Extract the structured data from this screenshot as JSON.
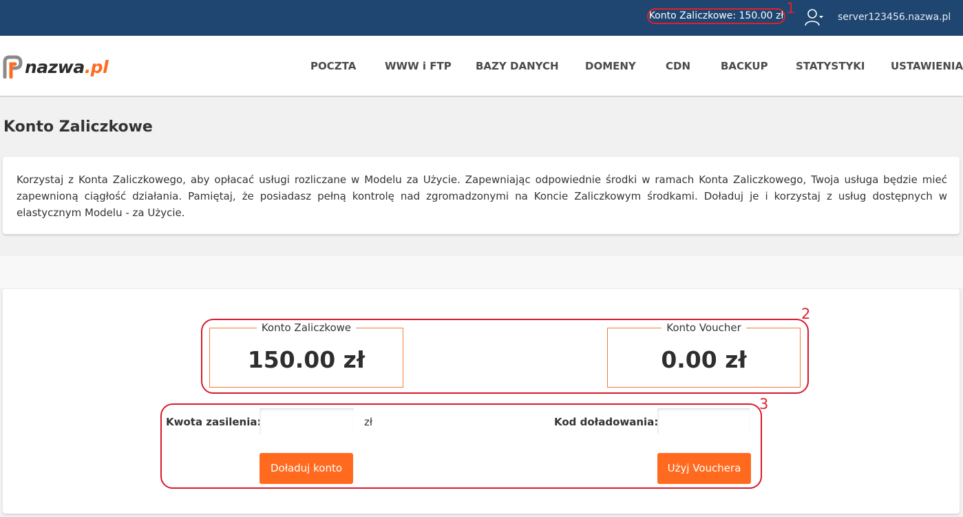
{
  "topbar": {
    "balance_label": "Konto Zaliczkowe: 150.00 zł",
    "server_name": "server123456.nazwa.pl",
    "annotation_1": "1"
  },
  "logo": {
    "brand": "nazwa",
    "tld": ".pl"
  },
  "nav": {
    "items": [
      {
        "label": "POCZTA"
      },
      {
        "label": "WWW i FTP"
      },
      {
        "label": "BAZY DANYCH"
      },
      {
        "label": "DOMENY"
      },
      {
        "label": "CDN"
      },
      {
        "label": "BACKUP"
      },
      {
        "label": "STATYSTYKI"
      },
      {
        "label": "USTAWIENIA"
      }
    ]
  },
  "page": {
    "title": "Konto Zaliczkowe",
    "description": "Korzystaj z Konta Zaliczkowego, aby opłacać usługi rozliczane w Modelu za Użycie. Zapewniając odpowiednie środki w ramach Konta Zaliczkowego, Twoja usługa będzie mieć zapewnioną ciągłość działania. Pamiętaj, że posiadasz pełną kontrolę nad zgromadzonymi na Koncie Zaliczkowym środkami. Doładuj je i korzystaj z usług dostępnych w elastycznym Modelu - za Użycie."
  },
  "accounts": {
    "annotation_2": "2",
    "advance": {
      "legend": "Konto Zaliczkowe",
      "amount": "150.00 zł"
    },
    "voucher": {
      "legend": "Konto Voucher",
      "amount": "0.00 zł"
    }
  },
  "forms": {
    "annotation_3": "3",
    "topup": {
      "label": "Kwota zasilenia:",
      "value": "",
      "unit": "zł",
      "button": "Doładuj konto"
    },
    "voucher": {
      "label": "Kod doładowania:",
      "value": "",
      "button": "Użyj Vouchera"
    }
  },
  "colors": {
    "topbar": "#1f4670",
    "accent": "#ff6a1f",
    "annotation": "#e0202c"
  }
}
